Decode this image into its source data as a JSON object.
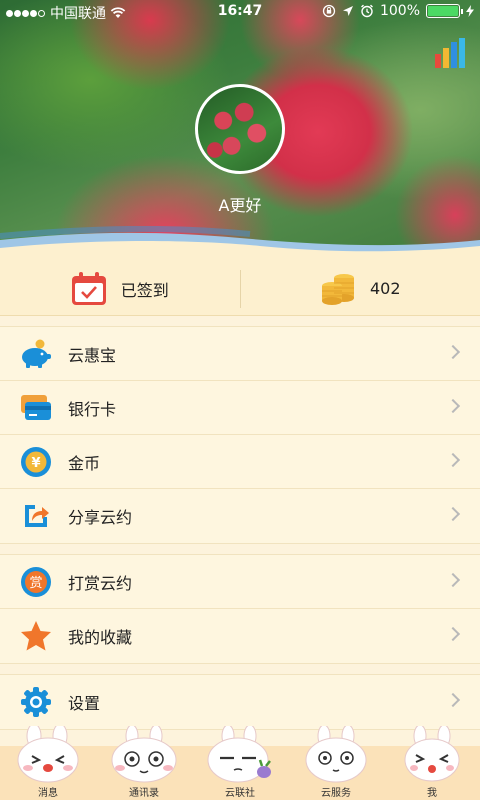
{
  "status_bar": {
    "carrier": "中国联通",
    "time": "16:47",
    "battery": "100%",
    "battery_level": 1.0
  },
  "profile": {
    "username": "A更好"
  },
  "stats": {
    "checkin_label": "已签到",
    "coins_value": "402"
  },
  "menu": {
    "group1": [
      {
        "label": "云惠宝",
        "icon": "piggy-bank-icon"
      },
      {
        "label": "银行卡",
        "icon": "bank-card-icon"
      },
      {
        "label": "金币",
        "icon": "yen-coin-icon"
      },
      {
        "label": "分享云约",
        "icon": "share-icon"
      }
    ],
    "group2": [
      {
        "label": "打赏云约",
        "icon": "reward-icon"
      },
      {
        "label": "我的收藏",
        "icon": "star-icon"
      }
    ],
    "group3": [
      {
        "label": "设置",
        "icon": "gear-icon"
      }
    ]
  },
  "tabs": [
    {
      "label": "消息"
    },
    {
      "label": "通讯录"
    },
    {
      "label": "云联社"
    },
    {
      "label": "云服务"
    },
    {
      "label": "我",
      "active": true
    }
  ],
  "colors": {
    "accent_blue": "#1a8fd8",
    "accent_orange": "#f0762b",
    "checkin_red": "#e5493f",
    "coin_gold": "#f2b83a",
    "battery_green": "#4cd964"
  }
}
